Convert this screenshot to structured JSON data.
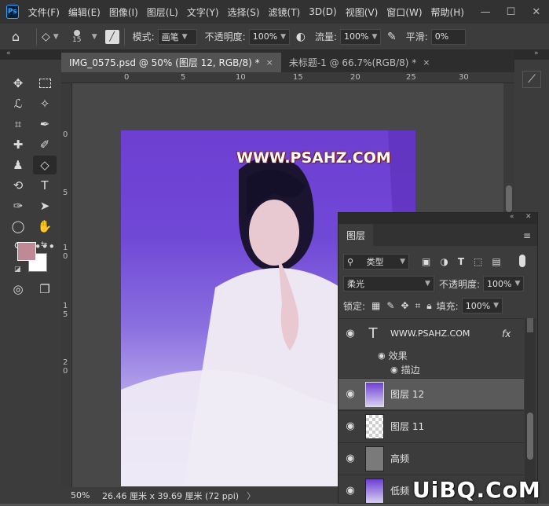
{
  "app": {
    "logo": "Ps"
  },
  "menu": [
    "文件(F)",
    "编辑(E)",
    "图像(I)",
    "图层(L)",
    "文字(Y)",
    "选择(S)",
    "滤镜(T)",
    "3D(D)",
    "视图(V)",
    "窗口(W)",
    "帮助(H)"
  ],
  "window_controls": {
    "minimize": "—",
    "maximize": "☐",
    "close": "✕"
  },
  "options": {
    "brush_size": "15",
    "mode_label": "模式:",
    "mode_value": "画笔",
    "opacity_label": "不透明度:",
    "opacity_value": "100%",
    "flow_label": "流量:",
    "flow_value": "100%",
    "smooth_label": "平滑:",
    "smooth_value": "0%"
  },
  "tabs": [
    {
      "label": "IMG_0575.psd @ 50% (图层 12, RGB/8) *",
      "close": "×"
    },
    {
      "label": "未标题-1 @ 66.7%(RGB/8) *",
      "close": "×"
    }
  ],
  "ruler_h": [
    "0",
    "5",
    "10",
    "15",
    "20",
    "25",
    "30"
  ],
  "ruler_v": [
    "0",
    "5",
    "1 0",
    "1 5",
    "2 0"
  ],
  "canvas": {
    "watermark": "WWW.PSAHZ.COM"
  },
  "status": {
    "zoom": "50%",
    "doc_size": "26.46 厘米 x 39.69 厘米 (72 ppi)",
    "arrow": "〉"
  },
  "colors": {
    "foreground": "#bf8a96",
    "background": "#ffffff"
  },
  "layers_panel": {
    "tab": "图层",
    "filter_label": "类型",
    "blend_mode": "柔光",
    "opacity_label": "不透明度:",
    "opacity_value": "100%",
    "lock_label": "锁定:",
    "fill_label": "填充:",
    "fill_value": "100%",
    "layers": [
      {
        "name": "WWW.PSAHZ.COM",
        "kind": "text",
        "fx": "fx"
      },
      {
        "name": "图层 12",
        "kind": "image"
      },
      {
        "name": "图层 11",
        "kind": "transparent"
      },
      {
        "name": "高频",
        "kind": "gray"
      },
      {
        "name": "低频",
        "kind": "image"
      }
    ],
    "effects_label": "效果",
    "stroke_label": "描边"
  },
  "site_watermark": "UiBQ.CoM"
}
